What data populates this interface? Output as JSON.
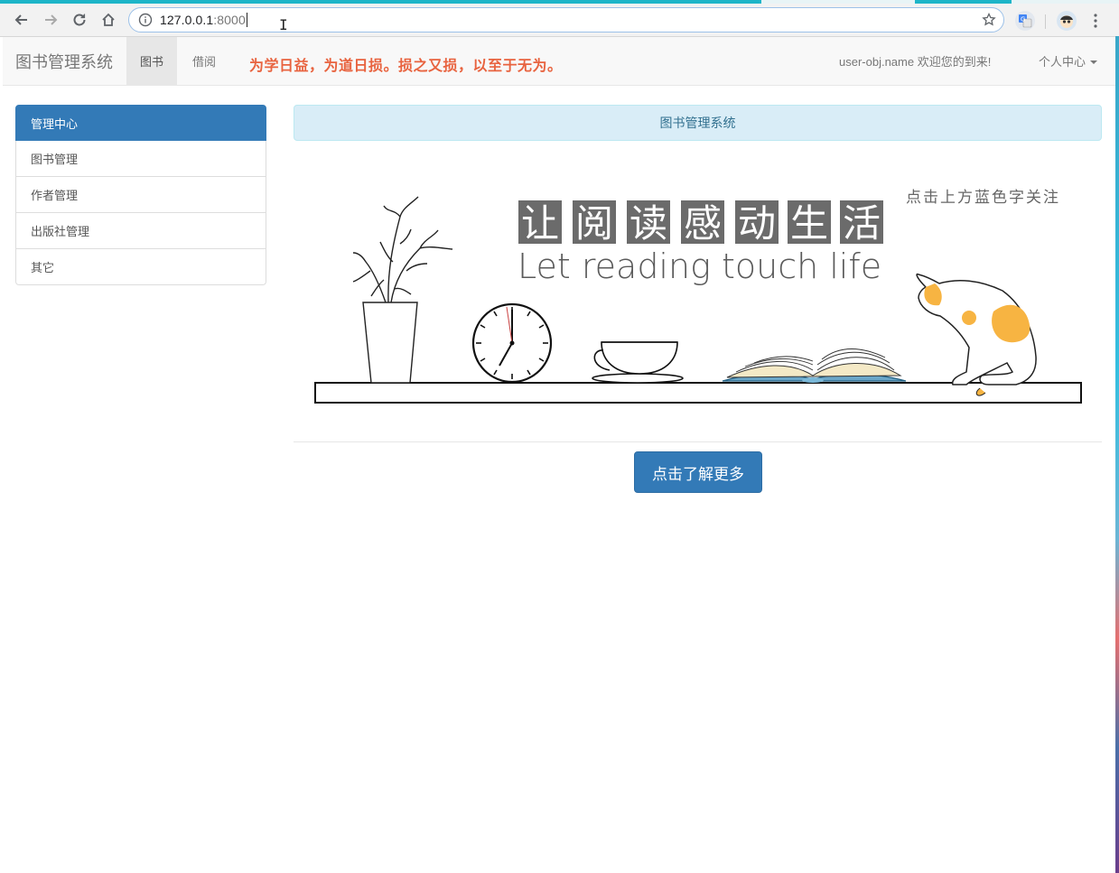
{
  "browser": {
    "url_host": "127.0.0.1",
    "url_port": ":8000",
    "icons": [
      "back-arrow-icon",
      "forward-arrow-icon",
      "reload-icon",
      "home-icon",
      "info-icon",
      "star-icon",
      "translate-icon",
      "extension-avatar-icon",
      "kebab-menu-icon"
    ]
  },
  "navbar": {
    "brand": "图书管理系统",
    "tabs": [
      {
        "label": "图书",
        "active": true
      },
      {
        "label": "借阅",
        "active": false
      }
    ],
    "motto": "为学日益，为道日损。损之又损，以至于无为。",
    "welcome": "user-obj.name 欢迎您的到来!",
    "user_menu": "个人中心"
  },
  "sidebar": {
    "items": [
      {
        "label": "管理中心",
        "active": true
      },
      {
        "label": "图书管理"
      },
      {
        "label": "作者管理"
      },
      {
        "label": "出版社管理"
      },
      {
        "label": "其它"
      }
    ]
  },
  "main": {
    "panel_title": "图书管理系统",
    "banner": {
      "chars": [
        "让",
        "阅",
        "读",
        "感",
        "动",
        "生",
        "活"
      ],
      "subtitle": "Let reading touch life",
      "hint": "点击上方蓝色字关注"
    },
    "more_button": "点击了解更多"
  },
  "colors": {
    "primary": "#337ab7",
    "motto": "#e8633f",
    "panel_bg": "#d9edf7",
    "panel_text": "#31708f",
    "cat_orange": "#f7b442"
  }
}
